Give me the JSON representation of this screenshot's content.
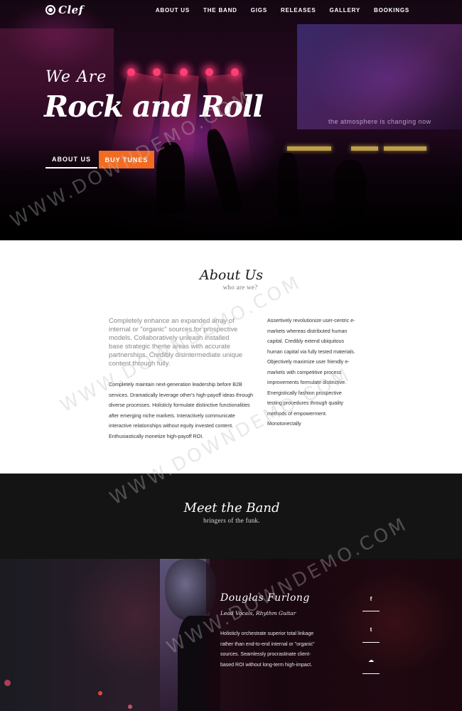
{
  "brand": {
    "logo_text": "Clef"
  },
  "nav": {
    "items": [
      "ABOUT US",
      "THE BAND",
      "GIGS",
      "RELEASES",
      "GALLERY",
      "BOOKINGS"
    ]
  },
  "hero": {
    "line1": "We Are",
    "line2": "Rock and Roll",
    "screen_text": "the atmosphere is changing now",
    "btn_about": "ABOUT US",
    "btn_buy": "BUY TUNES"
  },
  "about": {
    "title": "About Us",
    "subtitle": "who are we?",
    "lead": "Completely enhance an expanded array of internal or \"organic\" sources for prospective models. Collaboratively unleash installed base strategic theme areas with accurate partnerships. Credibly disintermediate unique content through fully.",
    "body": "Completely maintain next-generation leadership before B2B services. Dramatically leverage other's high-payoff ideas through diverse processes. Holisticly formulate distinctive functionalities after emerging niche markets. Interactively communicate interactive relationships without equity invested content. Enthusiastically monetize high-payoff ROI.",
    "right": "Assertively revolutionize user-centric e-markets whereas distributed human capital. Credibly extend ubiquitous human capital via fully tested materials. Objectively maximize user friendly e-markets with competitive process improvements formulate distinctive. Energistically fashion prospective testing procedures through quality methods of empowerment. Monotonectally"
  },
  "band": {
    "title": "Meet the Band",
    "subtitle": "bringers of the funk.",
    "member": {
      "name": "Douglas Furlong",
      "role": "Lead Vocals, Rhythm Guitar",
      "bio": "Holisticly orchestrate superior total linkage rather than end-to-end internal or \"organic\" sources. Seamlessly procrastinate client-based ROI without long-term high-impact.",
      "social": [
        "f",
        "t",
        "☁"
      ]
    }
  },
  "watermark": "WWW.DOWNDEMO.COM",
  "colors": {
    "accent": "#f26b21",
    "dark": "#141414"
  }
}
